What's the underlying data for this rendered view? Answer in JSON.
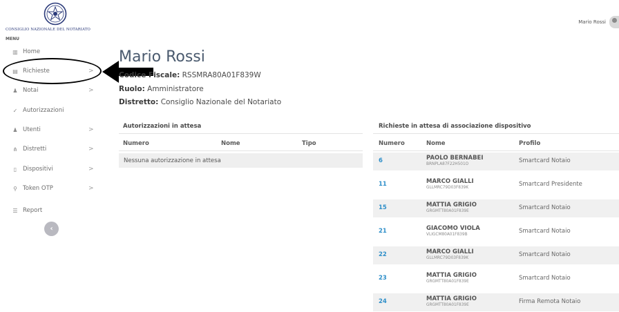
{
  "brand": {
    "org_name": "CONSIGLIO NAZIONALE DEL NOTARIATO",
    "menu_label": "MENU"
  },
  "sidebar": {
    "items": [
      {
        "label": "Home",
        "icon": "chart-icon",
        "has_chevron": false
      },
      {
        "label": "Richieste",
        "icon": "list-icon",
        "has_chevron": true
      },
      {
        "label": "Notai",
        "icon": "user-icon",
        "has_chevron": true
      },
      {
        "label": "Autorizzazioni",
        "icon": "check-icon",
        "has_chevron": false
      },
      {
        "label": "Utenti",
        "icon": "users-icon",
        "has_chevron": true
      },
      {
        "label": "Distretti",
        "icon": "sitemap-icon",
        "has_chevron": true
      },
      {
        "label": "Dispositivi",
        "icon": "device-icon",
        "has_chevron": true
      },
      {
        "label": "Token OTP",
        "icon": "key-icon",
        "has_chevron": true
      },
      {
        "label": "Report",
        "icon": "report-icon",
        "has_chevron": false
      }
    ],
    "chevron": ">",
    "collapse_glyph": "‹"
  },
  "header": {
    "user_name": "Mario Rossi"
  },
  "profile": {
    "name": "Mario Rossi",
    "codice_fiscale_label": "Codice Fiscale:",
    "codice_fiscale": "RSSMRA80A01F839W",
    "ruolo_label": "Ruolo:",
    "ruolo": "Amministratore",
    "distretto_label": "Distretto:",
    "distretto": "Consiglio Nazionale del Notariato"
  },
  "autorizzazioni": {
    "title": "Autorizzazioni in attesa",
    "columns": [
      "Numero",
      "Nome",
      "Tipo"
    ],
    "empty_message": "Nessuna autorizzazione in attesa"
  },
  "richieste": {
    "title": "Richieste in attesa di associazione dispositivo",
    "columns": [
      "Numero",
      "Nome",
      "Profilo"
    ],
    "rows": [
      {
        "num": "6",
        "name": "PAOLO BERNABEI",
        "cf": "BRNPLA87F22H501O",
        "profile": "Smartcard Notaio"
      },
      {
        "num": "11",
        "name": "MARCO GIALLI",
        "cf": "GLLMRC79D03F839K",
        "profile": "Smartcard Presidente"
      },
      {
        "num": "15",
        "name": "MATTIA GRIGIO",
        "cf": "GRGMTT80A01F839E",
        "profile": "Smartcard Notaio"
      },
      {
        "num": "21",
        "name": "GIACOMO VIOLA",
        "cf": "VLIGCM80A01F839B",
        "profile": "Smartcard Notaio"
      },
      {
        "num": "22",
        "name": "MARCO GIALLI",
        "cf": "GLLMRC79D03F839K",
        "profile": "Smartcard Notaio"
      },
      {
        "num": "23",
        "name": "MATTIA GRIGIO",
        "cf": "GRGMTT80A01F839E",
        "profile": "Smartcard Notaio"
      },
      {
        "num": "24",
        "name": "MATTIA GRIGIO",
        "cf": "GRGMTT80A01F839E",
        "profile": "Firma Remota Notaio"
      }
    ]
  },
  "colors": {
    "accent_link": "#2f8fc9",
    "title_text": "#4a5a6e",
    "emblem_navy": "#2b3a7a"
  }
}
